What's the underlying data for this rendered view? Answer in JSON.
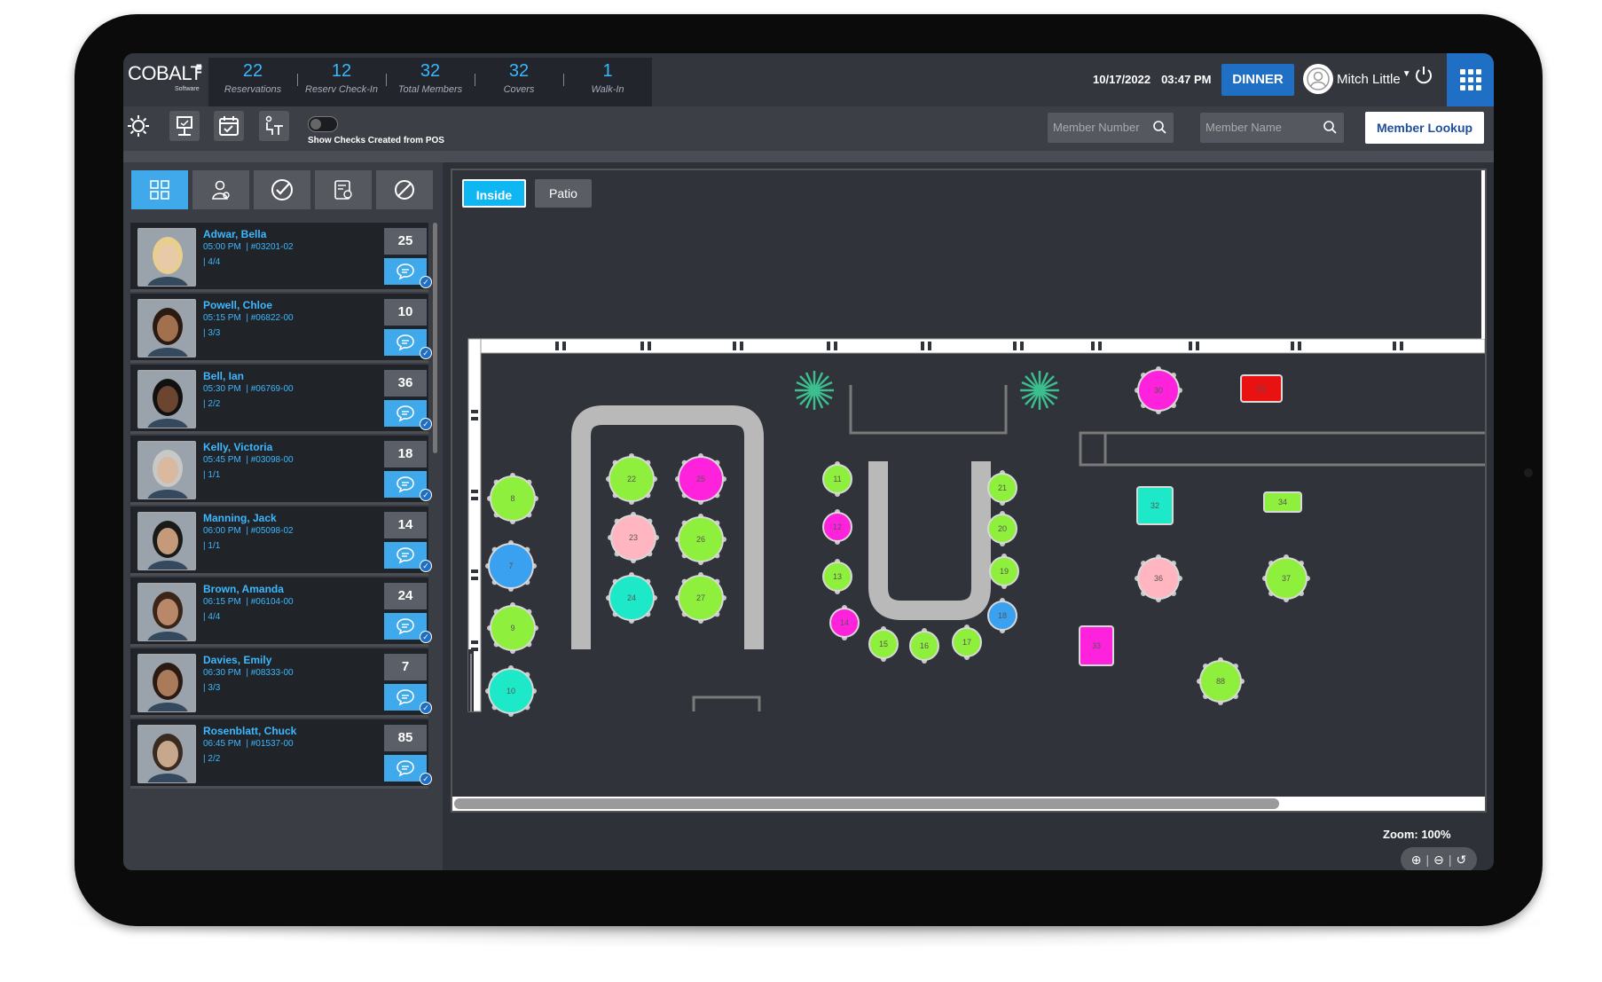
{
  "app": {
    "logo_word": "COBALT",
    "logo_sub": "Software"
  },
  "stats": [
    {
      "value": "22",
      "label": "Reservations"
    },
    {
      "value": "12",
      "label": "Reserv Check-In"
    },
    {
      "value": "32",
      "label": "Total Members"
    },
    {
      "value": "32",
      "label": "Covers"
    },
    {
      "value": "1",
      "label": "Walk-In"
    }
  ],
  "header": {
    "date": "10/17/2022",
    "time": "03:47 PM",
    "meal_period": "DINNER",
    "user_name": "Mitch Little"
  },
  "toolbar": {
    "toggle_label": "Show Checks Created from POS",
    "member_number_placeholder": "Member Number",
    "member_name_placeholder": "Member Name",
    "lookup_label": "Member Lookup"
  },
  "reservations": [
    {
      "name": "Adwar, Bella",
      "time": "05:00 PM",
      "member": "#03201-02",
      "party": "4/4",
      "count": "25"
    },
    {
      "name": "Powell, Chloe",
      "time": "05:15 PM",
      "member": "#06822-00",
      "party": "3/3",
      "count": "10"
    },
    {
      "name": "Bell, Ian",
      "time": "05:30 PM",
      "member": "#06769-00",
      "party": "2/2",
      "count": "36"
    },
    {
      "name": "Kelly, Victoria",
      "time": "05:45 PM",
      "member": "#03098-00",
      "party": "1/1",
      "count": "18"
    },
    {
      "name": "Manning, Jack",
      "time": "06:00 PM",
      "member": "#05098-02",
      "party": "1/1",
      "count": "14"
    },
    {
      "name": "Brown, Amanda",
      "time": "06:15 PM",
      "member": "#06104-00",
      "party": "4/4",
      "count": "24"
    },
    {
      "name": "Davies, Emily",
      "time": "06:30 PM",
      "member": "#08333-00",
      "party": "3/3",
      "count": "7"
    },
    {
      "name": "Rosenblatt, Chuck",
      "time": "06:45 PM",
      "member": "#01537-00",
      "party": "2/2",
      "count": "85"
    }
  ],
  "floor": {
    "tabs": [
      "Inside",
      "Patio"
    ],
    "active_tab": "Inside",
    "zoom_label": "Zoom: 100%",
    "status_colors": {
      "available": "#8ef03c",
      "seated": "#ff22dd",
      "reserved": "#3aa0f0",
      "check": "#ffb6c1",
      "cleared": "#1de9c8",
      "occupied": "#e81212"
    },
    "tables": [
      {
        "id": "8",
        "status": "available"
      },
      {
        "id": "7",
        "status": "reserved"
      },
      {
        "id": "9",
        "status": "available"
      },
      {
        "id": "10",
        "status": "cleared"
      },
      {
        "id": "22",
        "status": "available"
      },
      {
        "id": "25",
        "status": "seated"
      },
      {
        "id": "23",
        "status": "check"
      },
      {
        "id": "26",
        "status": "available"
      },
      {
        "id": "24",
        "status": "cleared"
      },
      {
        "id": "27",
        "status": "available"
      },
      {
        "id": "11",
        "status": "available"
      },
      {
        "id": "12",
        "status": "seated"
      },
      {
        "id": "13",
        "status": "available"
      },
      {
        "id": "14",
        "status": "seated"
      },
      {
        "id": "15",
        "status": "available"
      },
      {
        "id": "16",
        "status": "available"
      },
      {
        "id": "17",
        "status": "available"
      },
      {
        "id": "18",
        "status": "reserved"
      },
      {
        "id": "19",
        "status": "available"
      },
      {
        "id": "20",
        "status": "available"
      },
      {
        "id": "21",
        "status": "available"
      },
      {
        "id": "30",
        "status": "seated"
      },
      {
        "id": "31",
        "status": "occupied"
      },
      {
        "id": "32",
        "status": "cleared"
      },
      {
        "id": "34",
        "status": "available"
      },
      {
        "id": "36",
        "status": "check"
      },
      {
        "id": "37",
        "status": "available"
      },
      {
        "id": "33",
        "status": "seated"
      },
      {
        "id": "88",
        "status": "available"
      }
    ]
  }
}
